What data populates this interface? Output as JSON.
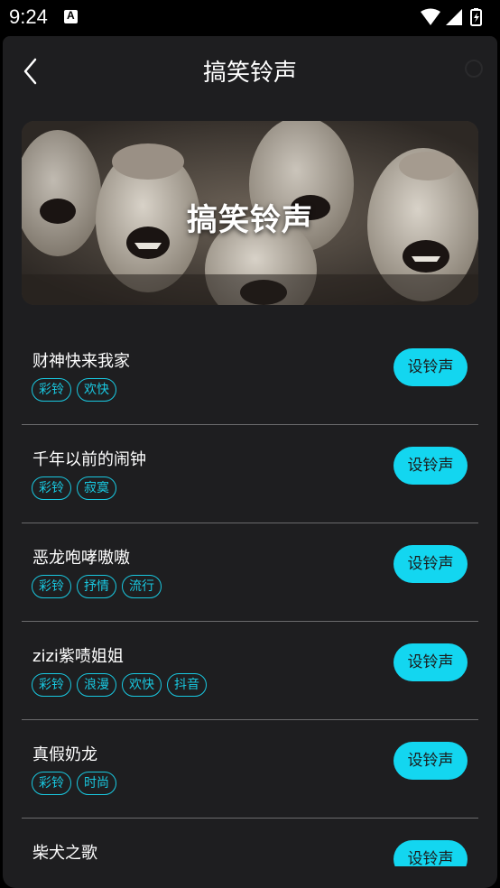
{
  "status_bar": {
    "time": "9:24",
    "notification_icon": "A"
  },
  "header": {
    "title": "搞笑铃声",
    "back_icon": "chevron-left-icon"
  },
  "banner": {
    "text": "搞笑铃声"
  },
  "list": {
    "items": [
      {
        "title": "财神快来我家",
        "tags": [
          "彩铃",
          "欢快"
        ],
        "button": "设铃声"
      },
      {
        "title": "千年以前的闹钟",
        "tags": [
          "彩铃",
          "寂寞"
        ],
        "button": "设铃声"
      },
      {
        "title": "恶龙咆哮嗷嗷",
        "tags": [
          "彩铃",
          "抒情",
          "流行"
        ],
        "button": "设铃声"
      },
      {
        "title": "zizi紫啧姐姐",
        "tags": [
          "彩铃",
          "浪漫",
          "欢快",
          "抖音"
        ],
        "button": "设铃声"
      },
      {
        "title": "真假奶龙",
        "tags": [
          "彩铃",
          "时尚"
        ],
        "button": "设铃声"
      },
      {
        "title": "柴犬之歌",
        "tags": [],
        "button": "设铃声"
      }
    ]
  },
  "colors": {
    "accent": "#13d6f0",
    "background": "#1e1e20"
  }
}
